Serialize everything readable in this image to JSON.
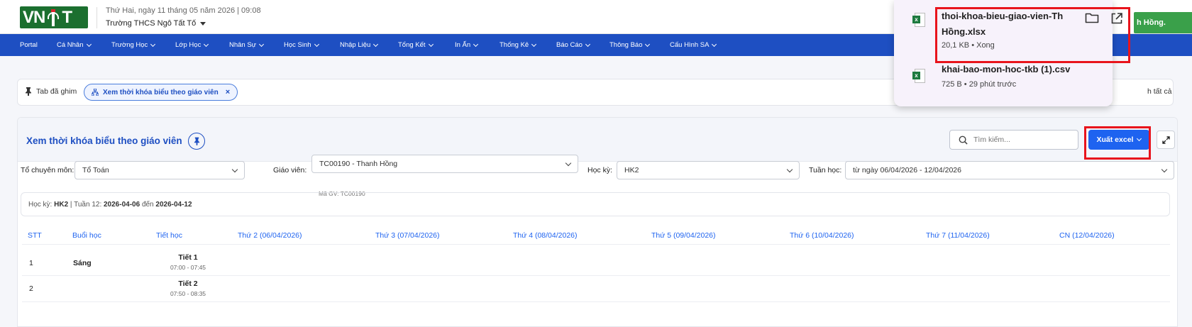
{
  "header": {
    "logo_left": "VN",
    "logo_right": "T",
    "date_text": "Thứ Hai, ngày 11 tháng 05 năm 2026 | 09:08",
    "school_name": "Trường THCS Ngô Tất Tố",
    "user_button_fragment": "h Hồng."
  },
  "nav": {
    "items": [
      {
        "label": "Portal"
      },
      {
        "label": "Cá Nhân"
      },
      {
        "label": "Trường Học"
      },
      {
        "label": "Lớp Học"
      },
      {
        "label": "Nhân Sự"
      },
      {
        "label": "Học Sinh"
      },
      {
        "label": "Nhập Liệu"
      },
      {
        "label": "Tổng Kết"
      },
      {
        "label": "In Ấn"
      },
      {
        "label": "Thống Kê"
      },
      {
        "label": "Báo Cáo"
      },
      {
        "label": "Thông Báo"
      },
      {
        "label": "Cấu Hình SA"
      }
    ]
  },
  "pinned": {
    "label": "Tab đã ghim",
    "chip_label": "Xem thời khóa biểu theo giáo viên",
    "chip_close": "×",
    "close_all_fragment": "h tất cả"
  },
  "card": {
    "title": "Xem thời khóa biểu theo giáo viên",
    "search_placeholder": "Tìm kiếm...",
    "export_label": "Xuất excel"
  },
  "filters": {
    "to_label": "Tổ chuyên môn:",
    "to_value": "Tổ Toán",
    "gv_label": "Giáo viên:",
    "gv_value": "TC00190 - Thanh Hồng",
    "gv_code": "Mã GV: TC00190",
    "hk_label": "Học kỳ:",
    "hk_value": "HK2",
    "tuan_label": "Tuần học:",
    "tuan_value": "từ ngày 06/04/2026 - 12/04/2026"
  },
  "info": {
    "hk_prefix": "Học kỳ:",
    "hk": "HK2",
    "week_prefix": "| Tuần 12:",
    "start": "2026-04-06",
    "mid": "đến",
    "end": "2026-04-12"
  },
  "table": {
    "headers": [
      "STT",
      "Buổi học",
      "Tiết học",
      "Thứ 2 (06/04/2026)",
      "Thứ 3 (07/04/2026)",
      "Thứ 4 (08/04/2026)",
      "Thứ 5 (09/04/2026)",
      "Thứ 6 (10/04/2026)",
      "Thứ 7 (11/04/2026)",
      "CN (12/04/2026)"
    ],
    "rows": [
      {
        "stt": "1",
        "session": "Sáng",
        "period": "Tiết 1",
        "time": "07:00 - 07:45"
      },
      {
        "stt": "2",
        "session": "",
        "period": "Tiết 2",
        "time": "07:50 - 08:35"
      }
    ]
  },
  "downloads": {
    "items": [
      {
        "name_line1": "thoi-khoa-bieu-giao-vien-Th",
        "name_line2": "Hồng.xlsx",
        "meta": "20,1 KB • Xong"
      },
      {
        "name_line1": "khai-bao-mon-hoc-tkb (1).csv",
        "meta": "725 B • 29 phút trước"
      }
    ]
  },
  "colors": {
    "nav_bg": "#1e4fc2",
    "accent": "#1e63f0",
    "highlight": "#e8141c",
    "logo_green": "#1b6f2f"
  }
}
